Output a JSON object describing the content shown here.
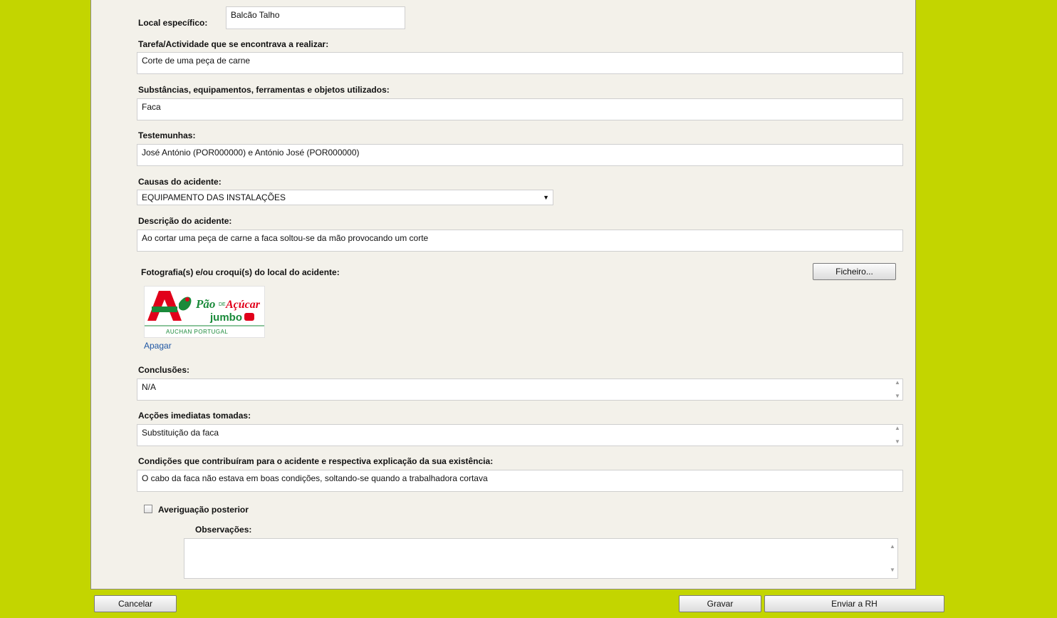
{
  "form": {
    "local_especifico": {
      "label": "Local específico:",
      "value": "Balcão Talho"
    },
    "tarefa": {
      "label": "Tarefa/Actividade que se encontrava a realizar:",
      "value": "Corte de uma peça de carne"
    },
    "substancias": {
      "label": "Substâncias, equipamentos, ferramentas e objetos utilizados:",
      "value": "Faca"
    },
    "testemunhas": {
      "label": "Testemunhas:",
      "value": "José António (POR000000) e António José (POR000000)"
    },
    "causas": {
      "label": "Causas do acidente:",
      "selected": "EQUIPAMENTO DAS INSTALAÇÕES"
    },
    "descricao": {
      "label": "Descrição do acidente:",
      "value": "Ao cortar uma peça de carne a faca soltou-se da mão provocando um corte"
    },
    "fotografias": {
      "label": "Fotografia(s) e/ou croqui(s) do local do acidente:",
      "file_button": "Ficheiro...",
      "delete_link": "Apagar",
      "logo_text": {
        "brand_line1": "Pão",
        "brand_line1b": "DE",
        "brand_line1c": "Açúcar",
        "brand_line2": "jumbo",
        "footer": "AUCHAN PORTUGAL"
      }
    },
    "conclusoes": {
      "label": "Conclusões:",
      "value": "N/A"
    },
    "accoes": {
      "label": "Acções imediatas tomadas:",
      "value": "Substituição da faca"
    },
    "condicoes": {
      "label": "Condições que contribuíram para o acidente e respectiva explicação da sua existência:",
      "value": "O cabo da faca não estava em boas condições, soltando-se quando a trabalhadora cortava"
    },
    "averiguacao": {
      "label": "Averiguação posterior",
      "checked": false
    },
    "observacoes": {
      "label": "Observações:",
      "value": ""
    }
  },
  "footer": {
    "cancel": "Cancelar",
    "save": "Gravar",
    "send": "Enviar a RH"
  },
  "colors": {
    "background": "#c3d500",
    "panel": "#f3f1ea",
    "link": "#1f57a4",
    "logo_red": "#e1001a",
    "logo_green": "#1a8a3a"
  }
}
